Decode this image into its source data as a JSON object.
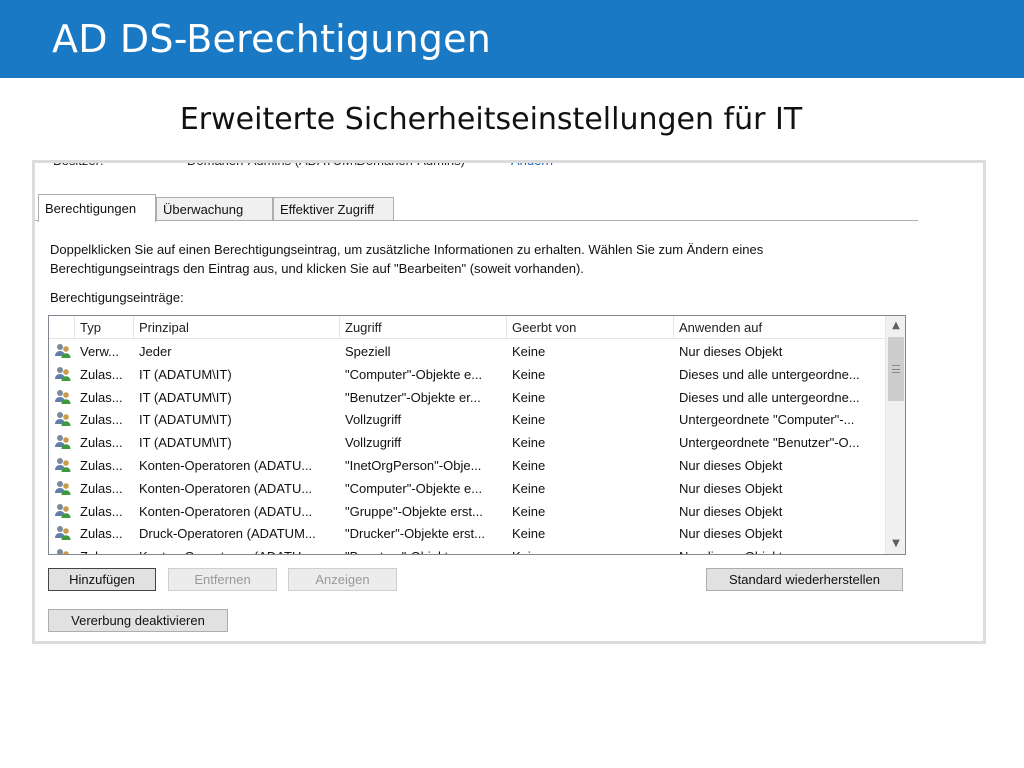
{
  "header": {
    "title": "AD DS-Berechtigungen"
  },
  "subtitle": "Erweiterte Sicherheitseinstellungen für IT",
  "owner": {
    "label": "Besitzer:",
    "value": "Domänen-Admins (ADATUM\\Domänen-Admins)",
    "change_link": "Ändern"
  },
  "tabs": [
    {
      "label": "Berechtigungen",
      "active": true
    },
    {
      "label": "Überwachung",
      "active": false
    },
    {
      "label": "Effektiver Zugriff",
      "active": false
    }
  ],
  "description": {
    "line1": "Doppelklicken Sie auf einen Berechtigungseintrag, um zusätzliche Informationen zu erhalten. Wählen Sie zum Ändern eines",
    "line2": "Berechtigungseintrags den Eintrag aus, und klicken Sie auf \"Bearbeiten\" (soweit vorhanden)."
  },
  "entries_label": "Berechtigungseinträge:",
  "columns": [
    "Typ",
    "Prinzipal",
    "Zugriff",
    "Geerbt von",
    "Anwenden auf"
  ],
  "rows": [
    {
      "type": "Verw...",
      "principal": "Jeder",
      "access": "Speziell",
      "inherited": "Keine",
      "applies": "Nur dieses Objekt"
    },
    {
      "type": "Zulas...",
      "principal": "IT (ADATUM\\IT)",
      "access": "\"Computer\"-Objekte e...",
      "inherited": "Keine",
      "applies": "Dieses und alle untergeordne..."
    },
    {
      "type": "Zulas...",
      "principal": "IT (ADATUM\\IT)",
      "access": "\"Benutzer\"-Objekte er...",
      "inherited": "Keine",
      "applies": "Dieses und alle untergeordne..."
    },
    {
      "type": "Zulas...",
      "principal": "IT (ADATUM\\IT)",
      "access": "Vollzugriff",
      "inherited": "Keine",
      "applies": "Untergeordnete \"Computer\"-..."
    },
    {
      "type": "Zulas...",
      "principal": "IT (ADATUM\\IT)",
      "access": "Vollzugriff",
      "inherited": "Keine",
      "applies": "Untergeordnete \"Benutzer\"-O..."
    },
    {
      "type": "Zulas...",
      "principal": "Konten-Operatoren (ADATU...",
      "access": "\"InetOrgPerson\"-Obje...",
      "inherited": "Keine",
      "applies": "Nur dieses Objekt"
    },
    {
      "type": "Zulas...",
      "principal": "Konten-Operatoren (ADATU...",
      "access": "\"Computer\"-Objekte e...",
      "inherited": "Keine",
      "applies": "Nur dieses Objekt"
    },
    {
      "type": "Zulas...",
      "principal": "Konten-Operatoren (ADATU...",
      "access": "\"Gruppe\"-Objekte erst...",
      "inherited": "Keine",
      "applies": "Nur dieses Objekt"
    },
    {
      "type": "Zulas...",
      "principal": "Druck-Operatoren (ADATUM...",
      "access": "\"Drucker\"-Objekte erst...",
      "inherited": "Keine",
      "applies": "Nur dieses Objekt"
    },
    {
      "type": "Zulas...",
      "principal": "Konten-Operatoren (ADATU...",
      "access": "\"Benutzer\"-Objekte er...",
      "inherited": "Keine",
      "applies": "Nur dieses Objekt"
    }
  ],
  "buttons": {
    "add": "Hinzufügen",
    "remove": "Entfernen",
    "view": "Anzeigen",
    "restore_defaults": "Standard wiederherstellen",
    "disable_inheritance": "Vererbung deaktivieren"
  },
  "colors": {
    "header_bg": "#1a79c4",
    "link": "#1a66c4"
  },
  "icons": {
    "row_icon": "user-group-icon"
  }
}
